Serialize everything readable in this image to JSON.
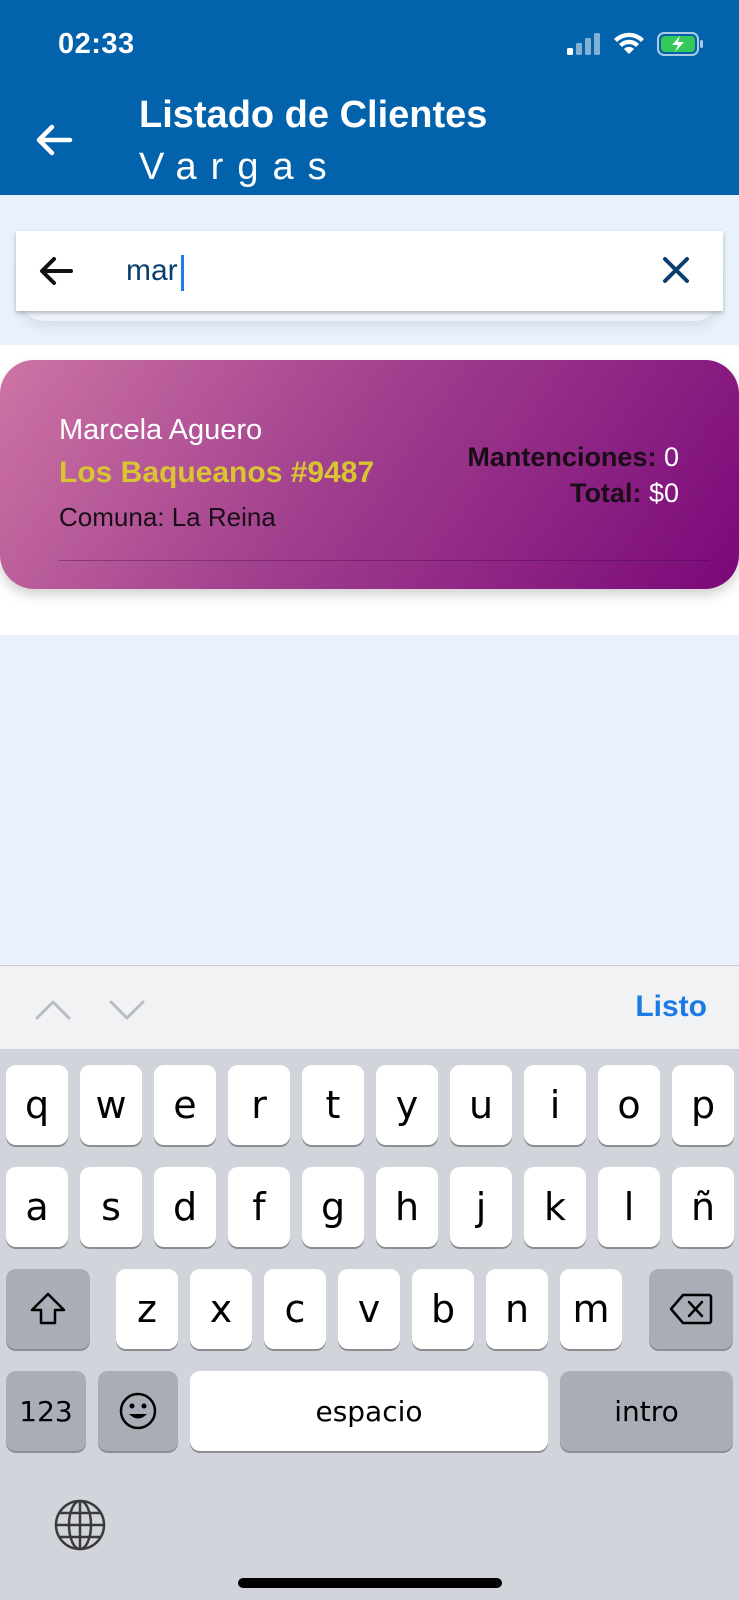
{
  "status": {
    "time": "02:33"
  },
  "header": {
    "title": "Listado de Clientes",
    "subtitle": "Vargas"
  },
  "search": {
    "value": "mar",
    "placeholder": ""
  },
  "clients": [
    {
      "name": "Marcela Aguero",
      "address": "Los Baqueanos #9487",
      "comuna": "Comuna: La Reina",
      "maint_label": "Mantenciones:",
      "maint_value": "0",
      "total_label": "Total:",
      "total_value": "$0"
    }
  ],
  "keyboard_toolbar": {
    "done": "Listo"
  },
  "keyboard": {
    "row1": [
      "q",
      "w",
      "e",
      "r",
      "t",
      "y",
      "u",
      "i",
      "o",
      "p"
    ],
    "row2": [
      "a",
      "s",
      "d",
      "f",
      "g",
      "h",
      "j",
      "k",
      "l",
      "ñ"
    ],
    "row3": [
      "z",
      "x",
      "c",
      "v",
      "b",
      "n",
      "m"
    ],
    "numbers": "123",
    "space": "espacio",
    "return": "intro"
  },
  "colors": {
    "header": "#0262ab",
    "accent_text": "#d9c431",
    "done": "#1b7ae6"
  },
  "icons": [
    "back-arrow-icon",
    "search-back-icon",
    "clear-icon",
    "signal-icon",
    "wifi-icon",
    "battery-charging-icon",
    "chevron-up-icon",
    "chevron-down-icon",
    "shift-icon",
    "backspace-icon",
    "emoji-icon",
    "globe-icon"
  ]
}
